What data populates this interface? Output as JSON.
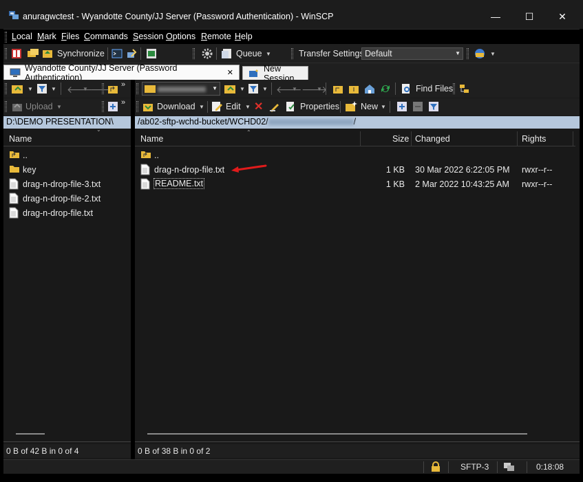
{
  "window": {
    "title": "anuragwctest - Wyandotte County/JJ Server (Password Authentication) - WinSCP",
    "minimize_glyph": "—",
    "maximize_glyph": "☐",
    "close_glyph": "✕"
  },
  "menu": [
    {
      "key": "L",
      "rest": "ocal"
    },
    {
      "key": "M",
      "rest": "ark"
    },
    {
      "key": "F",
      "rest": "iles"
    },
    {
      "key": "C",
      "rest": "ommands"
    },
    {
      "key": "S",
      "rest": "ession"
    },
    {
      "key": "O",
      "rest": "ptions"
    },
    {
      "key": "R",
      "rest": "emote"
    },
    {
      "key": "H",
      "rest": "elp"
    }
  ],
  "toolbar": {
    "synchronize": "Synchronize",
    "queue": "Queue",
    "transfer_settings": "Transfer Settings",
    "transfer_preset": "Default"
  },
  "tabs": {
    "active": "Wyandotte County/JJ Server (Password Authentication)",
    "new_session": "New Session",
    "close_glyph": "✕"
  },
  "local": {
    "upload": "Upload",
    "path": "D:\\DEMO PRESENTATION\\",
    "col_name": "Name",
    "files": [
      {
        "name": "..",
        "icon": "parent-folder-icon"
      },
      {
        "name": "key",
        "icon": "folder-icon"
      },
      {
        "name": "drag-n-drop-file-3.txt",
        "icon": "file-icon"
      },
      {
        "name": "drag-n-drop-file-2.txt",
        "icon": "file-icon"
      },
      {
        "name": "drag-n-drop-file.txt",
        "icon": "file-icon"
      }
    ],
    "status": "0 B of 42 B in 0 of 4"
  },
  "remote": {
    "find_files": "Find Files",
    "download": "Download",
    "edit": "Edit",
    "properties": "Properties",
    "new": "New",
    "path_prefix": "/ab02-sftp-wchd-bucket/WCHD02/",
    "path_suffix": "/",
    "columns": {
      "name": "Name",
      "size": "Size",
      "changed": "Changed",
      "rights": "Rights"
    },
    "files": [
      {
        "name": "..",
        "size": "",
        "changed": "",
        "rights": "",
        "icon": "parent-folder-icon"
      },
      {
        "name": "drag-n-drop-file.txt",
        "size": "1 KB",
        "changed": "30 Mar 2022 6:22:05 PM",
        "rights": "rwxr--r--",
        "icon": "file-icon"
      },
      {
        "name": "README.txt",
        "size": "1 KB",
        "changed": "2 Mar 2022 10:43:25 AM",
        "rights": "rwxr--r--",
        "icon": "file-icon"
      }
    ],
    "status": "0 B of 38 B in 0 of 2"
  },
  "statusbar": {
    "protocol": "SFTP-3",
    "elapsed": "0:18:08"
  },
  "colors": {
    "path_bar": "#b5c7dc",
    "annotation_arrow": "#e01b1b",
    "folder": "#e8b93a"
  }
}
